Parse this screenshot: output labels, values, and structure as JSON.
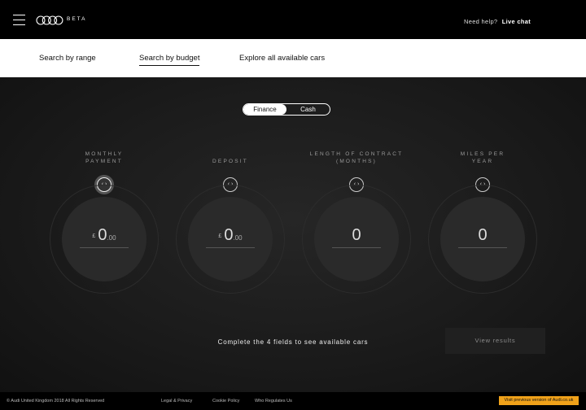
{
  "header": {
    "beta_label": "BETA",
    "help_text": "Need help?",
    "live_chat": "Live chat"
  },
  "nav": {
    "items": [
      {
        "label": "Search by range"
      },
      {
        "label": "Search by budget",
        "active": true
      },
      {
        "label": "Explore all available cars"
      }
    ]
  },
  "toggle": {
    "options": [
      "Finance",
      "Cash"
    ],
    "selected": "Finance"
  },
  "fields": [
    {
      "label": "MONTHLY PAYMENT",
      "currency": "£",
      "value": "0",
      "decimals": ".00"
    },
    {
      "label": "DEPOSIT",
      "currency": "£",
      "value": "0",
      "decimals": ".00"
    },
    {
      "label": "LENGTH OF CONTRACT (MONTHS)",
      "value": "0"
    },
    {
      "label": "MILES PER YEAR",
      "value": "0"
    }
  ],
  "arrows_glyph": "‹ ›",
  "instruction": "Complete the 4 fields to see available cars",
  "view_results": "View results",
  "footer": {
    "copyright": "© Audi United Kingdom 2018 All Rights Reserved",
    "links": [
      "Legal & Privacy",
      "Cookie Policy",
      "Who Regulates Us"
    ],
    "previous_version": "Visit previous version of Audi.co.uk"
  },
  "colors": {
    "accent": "#f0a21a",
    "background": "#1b1b1b"
  }
}
